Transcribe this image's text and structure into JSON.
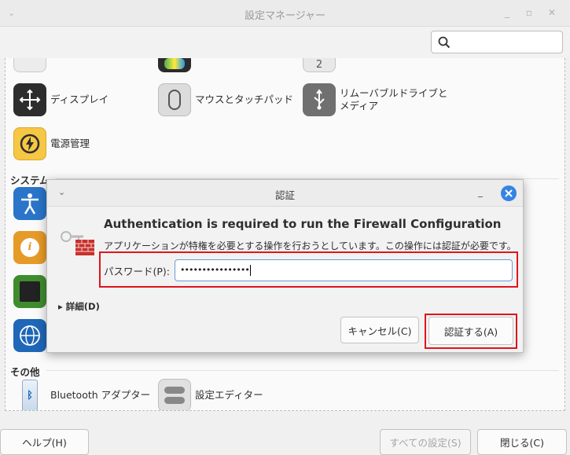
{
  "window": {
    "title": "設定マネージャー",
    "search_placeholder": ""
  },
  "sections": {
    "hardware_items": [
      {
        "label": "ディスプレイ"
      },
      {
        "label": "マウスとタッチパッド"
      },
      {
        "label_line1": "リムーバブルドライブと",
        "label_line2": "メディア"
      },
      {
        "label": "電源管理"
      }
    ],
    "partial_top_number": "2",
    "system_heading": "システム",
    "other_heading": "その他",
    "other_items": [
      {
        "label": "Bluetooth アダプター"
      },
      {
        "label": "設定エディター"
      }
    ]
  },
  "bottom": {
    "help_label": "ヘルプ(H)",
    "all_settings_label": "すべての設定(S)",
    "close_label": "閉じる(C)"
  },
  "dialog": {
    "title": "認証",
    "heading": "Authentication is required to run the Firewall Configuration",
    "description": "アプリケーションが特権を必要とする操作を行おうとしています。この操作には認証が必要です。",
    "password_label": "パスワード(P):",
    "password_value": "••••••••••••••••",
    "details_label": "詳細(D)",
    "cancel_label": "キャンセル(C)",
    "authenticate_label": "認証する(A)"
  },
  "colors": {
    "highlight": "#e0141c",
    "accent": "#3584e4"
  }
}
